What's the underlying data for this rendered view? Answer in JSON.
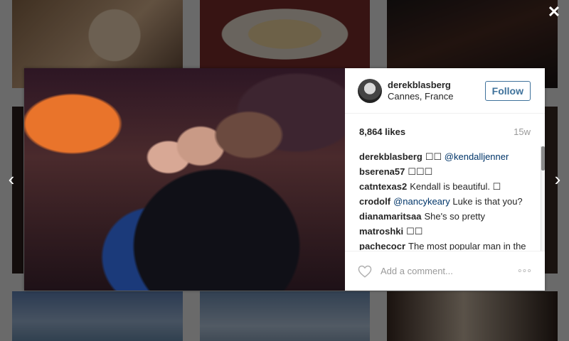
{
  "lightbox": {
    "close_glyph": "✕",
    "prev_glyph": "‹",
    "next_glyph": "›"
  },
  "post": {
    "author": {
      "username": "derekblasberg",
      "location": "Cannes, France",
      "follow_label": "Follow"
    },
    "likes": "8,864 likes",
    "age": "15w",
    "comments": [
      {
        "author": "derekblasberg",
        "text": "",
        "mention": "@kendalljenner",
        "pre": "☐☐ "
      },
      {
        "author": "bserena57",
        "text": "☐☐☐",
        "mention": "",
        "pre": ""
      },
      {
        "author": "catntexas2",
        "text": "Kendall is beautiful. ☐",
        "mention": "",
        "pre": ""
      },
      {
        "author": "crodolf",
        "text": " Luke is that you?",
        "mention": "@nancykeary",
        "pre": ""
      },
      {
        "author": "dianamaritsaa",
        "text": "She's so pretty",
        "mention": "",
        "pre": ""
      },
      {
        "author": "matroshki",
        "text": "☐☐",
        "mention": "",
        "pre": ""
      },
      {
        "author": "pachecocr",
        "text": "The most popular man in the",
        "mention": "",
        "pre": ""
      }
    ],
    "add_comment_placeholder": "Add a comment...",
    "more_glyph": "◦◦◦"
  },
  "colors": {
    "link_blue": "#3f729b",
    "mention_blue": "#003569"
  },
  "icons": {
    "close": "close-icon",
    "prev": "chevron-left-icon",
    "next": "chevron-right-icon",
    "like": "heart-icon",
    "more": "more-options-icon"
  }
}
